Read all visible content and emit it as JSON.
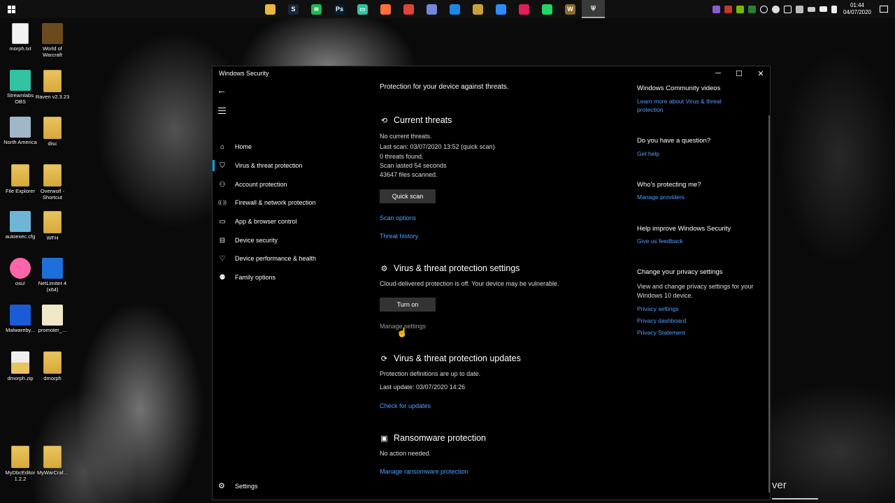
{
  "taskbar": {
    "apps": [
      {
        "icon": "file-explorer-icon",
        "color": "#e8b93c",
        "glyph": ""
      },
      {
        "icon": "steam-icon",
        "color": "#1b2838",
        "glyph": "S"
      },
      {
        "icon": "spotify-icon",
        "color": "#1db954",
        "glyph": "≋"
      },
      {
        "icon": "photoshop-icon",
        "color": "#001e36",
        "glyph": "Ps"
      },
      {
        "icon": "streamlabs-icon",
        "color": "#31c3a2",
        "glyph": "▭"
      },
      {
        "icon": "firefox-icon",
        "color": "#ff7139",
        "glyph": ""
      },
      {
        "icon": "chrome-icon",
        "color": "#db4437",
        "glyph": ""
      },
      {
        "icon": "discord-icon",
        "color": "#7289da",
        "glyph": ""
      },
      {
        "icon": "messenger-icon",
        "color": "#1e88e5",
        "glyph": ""
      },
      {
        "icon": "game-icon",
        "color": "#c9a13b",
        "glyph": ""
      },
      {
        "icon": "zoom-icon",
        "color": "#2d8cff",
        "glyph": ""
      },
      {
        "icon": "slack-icon",
        "color": "#e01e5a",
        "glyph": ""
      },
      {
        "icon": "whatsapp-icon",
        "color": "#25d366",
        "glyph": ""
      },
      {
        "icon": "wow-icon",
        "color": "#8a6d2b",
        "glyph": "W"
      },
      {
        "icon": "windows-security-icon",
        "color": "#3a3a3a",
        "glyph": "⛨"
      }
    ],
    "clock_time": "01:44",
    "clock_date": "04/07/2020"
  },
  "desktop_icons": [
    {
      "label": "morph.txt",
      "kind": "doc"
    },
    {
      "label": "World of Warcraft",
      "kind": "wow"
    },
    {
      "label": "Streamlabs OBS",
      "kind": "slobs"
    },
    {
      "label": "Raven v2.3.23",
      "kind": "folder"
    },
    {
      "label": "North America",
      "kind": "recycle"
    },
    {
      "label": "disc",
      "kind": "folder"
    },
    {
      "label": "File Explorer",
      "kind": "folder"
    },
    {
      "label": "Overwolf - Shortcut",
      "kind": "folder"
    },
    {
      "label": "autoexec.cfg",
      "kind": "cfg"
    },
    {
      "label": "WFH",
      "kind": "folder"
    },
    {
      "label": "osu!",
      "kind": "osu"
    },
    {
      "label": "NetLimiter 4 (x64)",
      "kind": "netlimiter"
    },
    {
      "label": "Malwareby...",
      "kind": "malwarebytes"
    },
    {
      "label": "promoter_...",
      "kind": "image"
    },
    {
      "label": "dmorph.zip",
      "kind": "zip"
    },
    {
      "label": "dmorph",
      "kind": "folder"
    },
    {
      "label": "MyDbcEditor 1.2.2",
      "kind": "folder"
    },
    {
      "label": "MyWarCraf...",
      "kind": "folder"
    }
  ],
  "window": {
    "title": "Windows Security",
    "minimize": "─",
    "maximize": "☐",
    "close": "✕"
  },
  "sidebar": {
    "items": [
      {
        "label": "Home",
        "icon": "home-icon",
        "glyph": "⌂"
      },
      {
        "label": "Virus & threat protection",
        "icon": "shield-icon",
        "glyph": "⛉"
      },
      {
        "label": "Account protection",
        "icon": "person-icon",
        "glyph": "⚇"
      },
      {
        "label": "Firewall & network protection",
        "icon": "wifi-icon",
        "glyph": "((·))"
      },
      {
        "label": "App & browser control",
        "icon": "window-icon",
        "glyph": "▭"
      },
      {
        "label": "Device security",
        "icon": "laptop-icon",
        "glyph": "⊟"
      },
      {
        "label": "Device performance & health",
        "icon": "heart-icon",
        "glyph": "♡"
      },
      {
        "label": "Family options",
        "icon": "family-icon",
        "glyph": "⚉"
      }
    ],
    "settings_label": "Settings"
  },
  "main": {
    "intro": "Protection for your device against threats.",
    "current_threats": {
      "heading": "Current threats",
      "lines": [
        "No current threats.",
        "Last scan: 03/07/2020 13:52 (quick scan)",
        "0 threats found.",
        "Scan lasted 54 seconds",
        "43647 files scanned."
      ],
      "quick_scan": "Quick scan",
      "scan_options": "Scan options",
      "threat_history": "Threat history"
    },
    "settings": {
      "heading": "Virus & threat protection settings",
      "status": "Cloud-delivered protection is off. Your device may be vulnerable.",
      "turn_on": "Turn on",
      "manage": "Manage settings"
    },
    "updates": {
      "heading": "Virus & threat protection updates",
      "status": "Protection definitions are up to date.",
      "last_update": "Last update: 03/07/2020 14:26",
      "check": "Check for updates"
    },
    "ransomware": {
      "heading": "Ransomware protection",
      "status": "No action needed.",
      "manage": "Manage ransomware protection"
    }
  },
  "right_panel": {
    "videos_heading": "Windows Community videos",
    "videos_link": "Learn more about Virus & threat protection",
    "question_heading": "Do you have a question?",
    "get_help": "Get help",
    "protecting_heading": "Who's protecting me?",
    "manage_providers": "Manage providers",
    "improve_heading": "Help improve Windows Security",
    "feedback": "Give us feedback",
    "privacy_heading": "Change your privacy settings",
    "privacy_text": "View and change privacy settings for your Windows 10 device.",
    "privacy_settings": "Privacy settings",
    "privacy_dashboard": "Privacy dashboard",
    "privacy_statement": "Privacy Statement"
  },
  "overlay_text": "ver",
  "colors": {
    "accent": "#00a4ef",
    "link": "#4ea1ff",
    "button": "#333333"
  }
}
